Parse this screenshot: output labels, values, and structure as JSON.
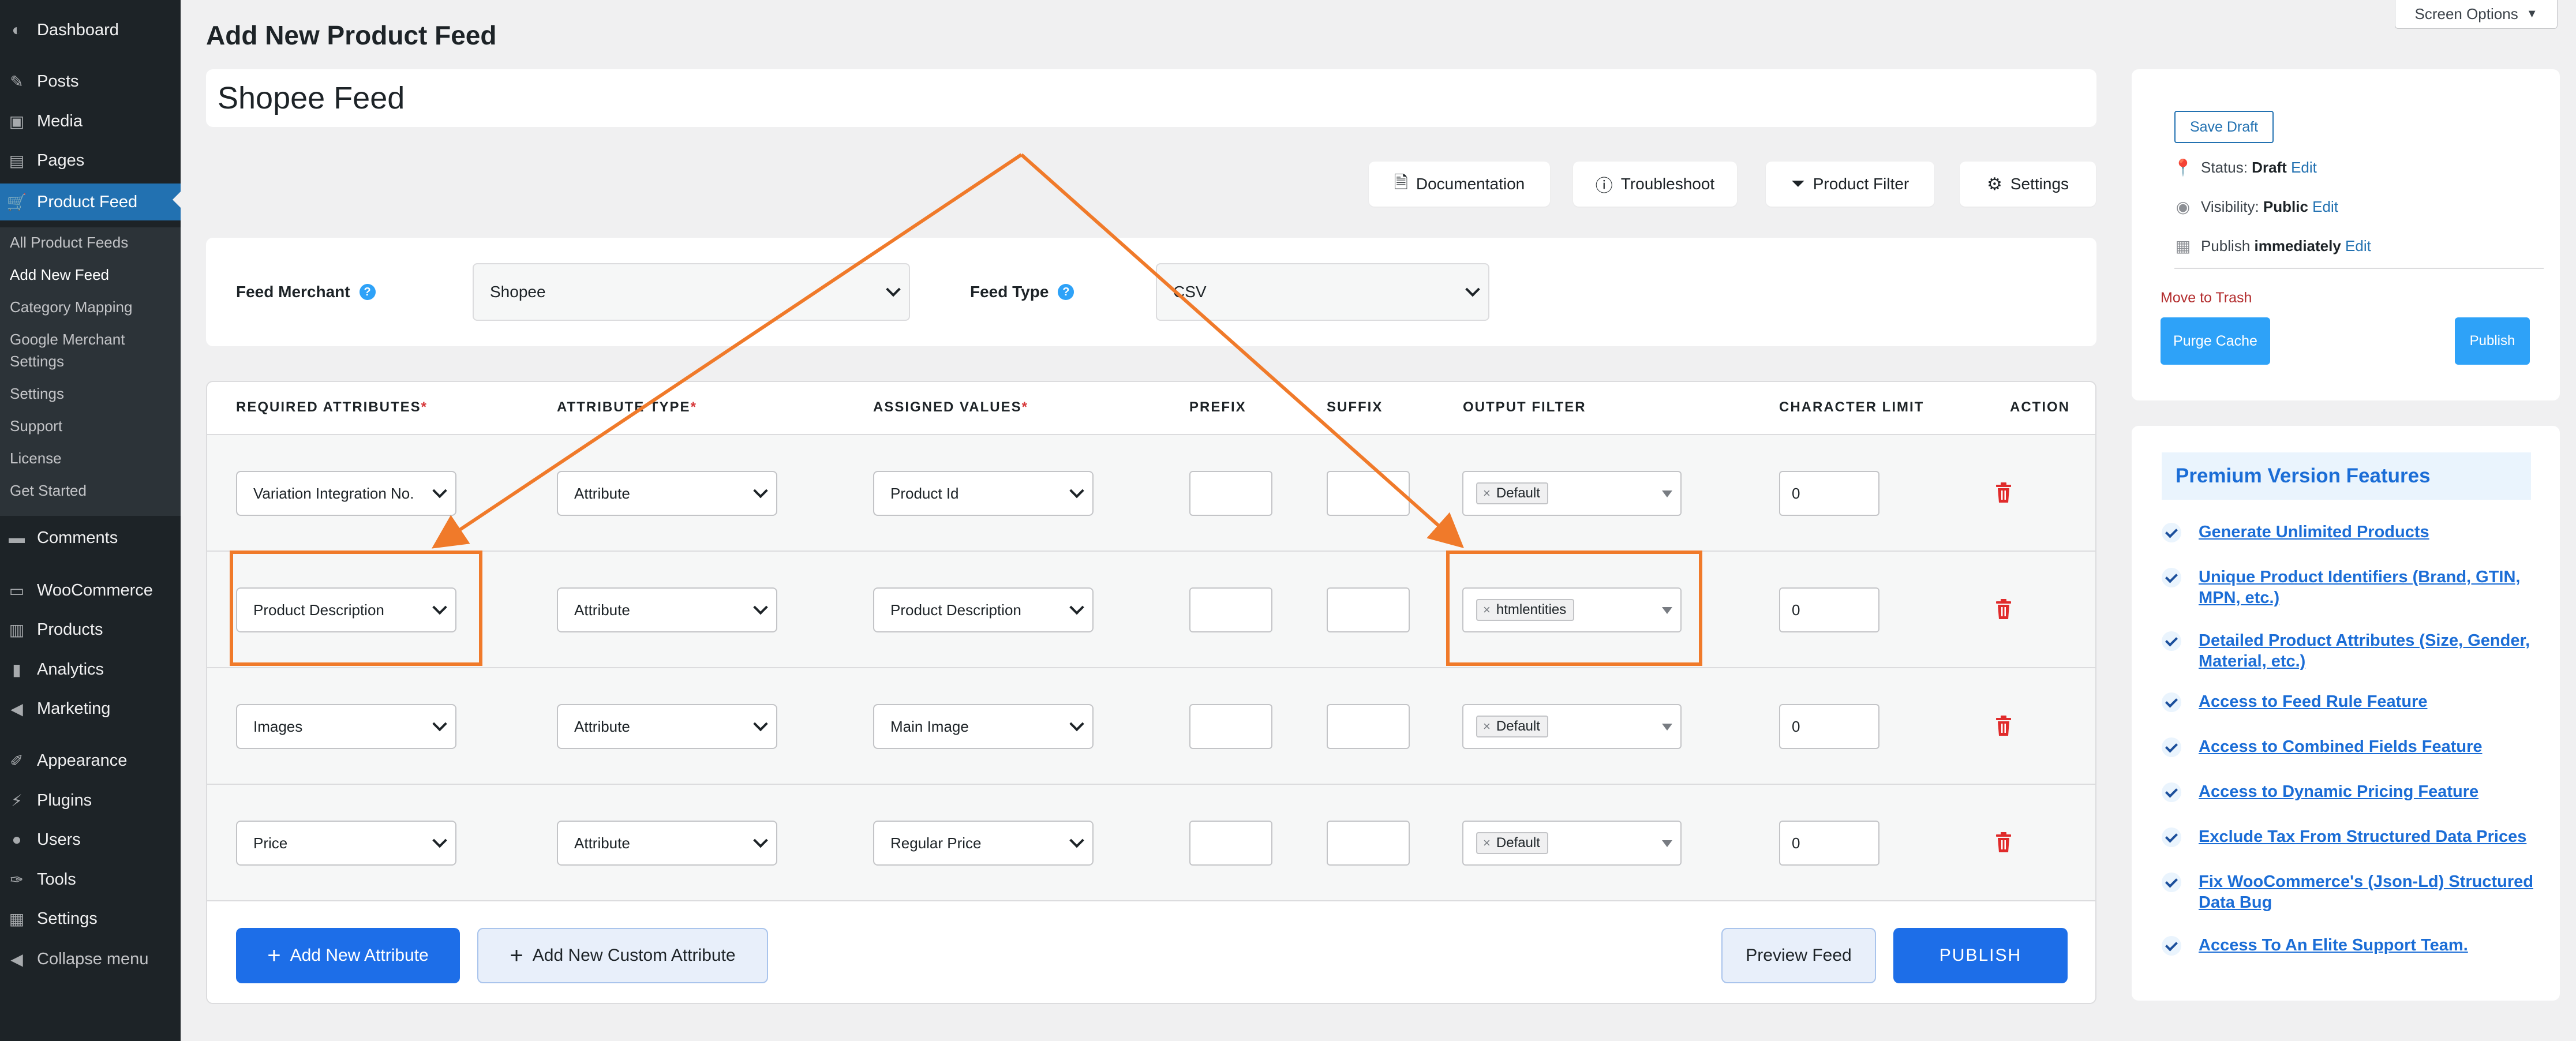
{
  "sidebar": {
    "dashboard": "Dashboard",
    "posts": "Posts",
    "media": "Media",
    "pages": "Pages",
    "product_feed": "Product Feed",
    "submenu": [
      "All Product Feeds",
      "Add New Feed",
      "Category Mapping",
      "Google Merchant",
      "Settings",
      "Settings",
      "Support",
      "License",
      "Get Started"
    ],
    "comments": "Comments",
    "woocommerce": "WooCommerce",
    "products": "Products",
    "analytics": "Analytics",
    "marketing": "Marketing",
    "appearance": "Appearance",
    "plugins": "Plugins",
    "users": "Users",
    "tools": "Tools",
    "settings": "Settings",
    "collapse": "Collapse menu"
  },
  "header": {
    "page_title": "Add New Product Feed",
    "screen_options": "Screen Options",
    "feed_title": "Shopee Feed"
  },
  "toolbar": {
    "documentation": "Documentation",
    "troubleshoot": "Troubleshoot",
    "product_filter": "Product Filter",
    "settings": "Settings"
  },
  "merchant": {
    "feed_merchant_label": "Feed Merchant",
    "feed_merchant_value": "Shopee",
    "feed_type_label": "Feed Type",
    "feed_type_value": "CSV",
    "help": "?"
  },
  "table": {
    "headers": {
      "required": "REQUIRED ATTRIBUTES",
      "type": "ATTRIBUTE TYPE",
      "assigned": "ASSIGNED VALUES",
      "prefix": "PREFIX",
      "suffix": "SUFFIX",
      "output": "OUTPUT FILTER",
      "limit": "CHARACTER LIMIT",
      "action": "ACTION",
      "asterisk": "*"
    },
    "rows": [
      {
        "attribute": "Variation Integration No.",
        "type": "Attribute",
        "value": "Product Id",
        "filter": "Default",
        "limit": "0"
      },
      {
        "attribute": "Product Description",
        "type": "Attribute",
        "value": "Product Description",
        "filter": "htmlentities",
        "limit": "0"
      },
      {
        "attribute": "Images",
        "type": "Attribute",
        "value": "Main Image",
        "filter": "Default",
        "limit": "0"
      },
      {
        "attribute": "Price",
        "type": "Attribute",
        "value": "Regular Price",
        "filter": "Default",
        "limit": "0"
      }
    ],
    "chip_remove": "×"
  },
  "footer": {
    "add_attribute": "Add New Attribute",
    "add_custom": "Add New Custom Attribute",
    "preview": "Preview Feed",
    "publish": "PUBLISH",
    "plus": "+"
  },
  "publish_box": {
    "save_draft": "Save Draft",
    "status_label": "Status:",
    "status_value": "Draft",
    "visibility_label": "Visibility:",
    "visibility_value": "Public",
    "publish_label": "Publish",
    "publish_value": "immediately",
    "edit": "Edit",
    "move_trash": "Move to Trash",
    "purge": "Purge Cache",
    "publish": "Publish"
  },
  "premium": {
    "title": "Premium Version Features",
    "features": [
      "Generate Unlimited Products",
      "Unique Product Identifiers (Brand, GTIN, MPN, etc.)",
      "Detailed Product Attributes (Size, Gender, Material, etc.)",
      "Access to Feed Rule Feature",
      "Access to Combined Fields Feature",
      "Access to Dynamic Pricing Feature",
      "Exclude Tax From Structured Data Prices",
      "Fix WooCommerce's (Json-Ld) Structured Data Bug",
      "Access To An Elite Support Team."
    ]
  },
  "colors": {
    "accent": "#2271b1",
    "publish_blue": "#1d6ee8",
    "light_blue": "#2ea2f8",
    "annotation": "#f07a2a",
    "delete": "#e02b2b"
  }
}
